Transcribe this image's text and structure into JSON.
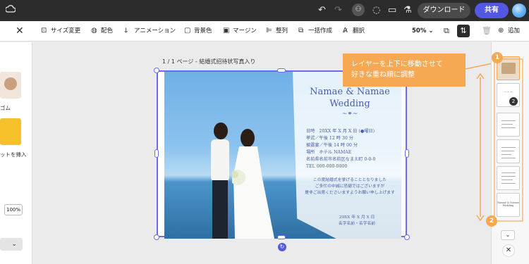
{
  "topbar": {
    "cloud_icon": "cloud-icon",
    "undo_icon": "undo-icon",
    "redo_icon": "redo-icon",
    "download_label": "ダウンロード",
    "share_label": "共有"
  },
  "toolbar": {
    "items": [
      {
        "label": "サイズ変更",
        "icon": "resize-icon"
      },
      {
        "label": "配色",
        "icon": "palette-icon"
      },
      {
        "label": "アニメーション",
        "icon": "animation-icon"
      },
      {
        "label": "背景色",
        "icon": "background-color-icon"
      },
      {
        "label": "マージン",
        "icon": "margin-icon"
      },
      {
        "label": "整列",
        "icon": "align-icon"
      },
      {
        "label": "一括作成",
        "icon": "bulk-create-icon"
      },
      {
        "label": "翻訳",
        "icon": "translate-icon"
      }
    ],
    "zoom": "50%",
    "add_label": "追加"
  },
  "left_panel": {
    "label1": "ゴム",
    "label2": "ットを挿入",
    "zoom": "100%"
  },
  "canvas": {
    "page_caption": "1 / 1 ページ - 結婚式招待状写真入り"
  },
  "invitation": {
    "title_line1": "Namae & Namae",
    "title_line2": "Wedding",
    "details": [
      "日時　20XX 年 X 月 X 日 (●曜日)",
      "挙式／午後 12 時 30 分",
      "披露宴／午後 14 時 00 分",
      "場所　ホテル NAMAE",
      "名前県名前市名前区なまえ町 0-0-0",
      "TEL 000-000-0000"
    ],
    "message": [
      "この度結婚式を挙げることとなりました",
      "ご多忙の中誠に恐縮ではございますが",
      "是非ご出席くださいますようお願い申し上げます"
    ],
    "signature": [
      "20XX 年 X 月 X 日",
      "名字名前・名字名前"
    ]
  },
  "tooltip": {
    "line1": "レイヤーを上下に移動させて",
    "line2": "好きな重ね順に調整",
    "badge1": "1",
    "badge2": "2"
  },
  "pages": {
    "count_badge": "2",
    "thumb_title": "Namae & Namae Wedding"
  },
  "colors": {
    "accent": "#5258e4",
    "selection": "#6a6cf0",
    "tooltip": "#f6a853"
  }
}
